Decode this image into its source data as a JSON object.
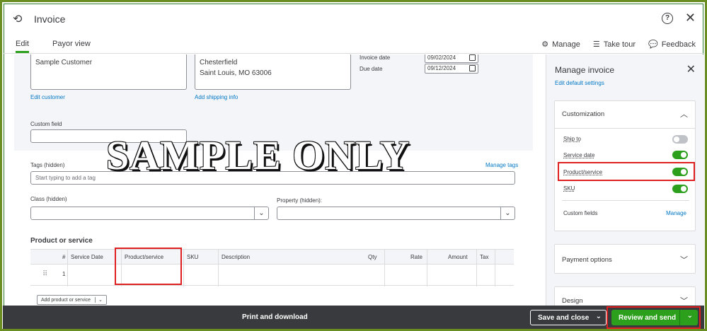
{
  "header": {
    "title": "Invoice",
    "help_label": "?",
    "close_label": "✕"
  },
  "tabs": [
    {
      "label": "Edit"
    },
    {
      "label": "Payor view"
    }
  ],
  "toolbar": {
    "manage": "Manage",
    "take_tour": "Take tour",
    "feedback": "Feedback"
  },
  "customer": {
    "name": "Sample Customer",
    "edit_link": "Edit customer",
    "shipping_line1": "Chesterfield",
    "shipping_line2": "Saint Louis, MO 63006",
    "add_shipping_link": "Add shipping info"
  },
  "dates": {
    "invoice_label": "Invoice date",
    "invoice_value": "09/02/2024",
    "due_label": "Due date",
    "due_value": "09/12/2024"
  },
  "custom_field": {
    "label": "Custom field",
    "value": ""
  },
  "tags": {
    "label": "Tags (hidden)",
    "manage_link": "Manage tags",
    "placeholder": "Start typing to add a tag"
  },
  "class_field": {
    "label": "Class (hidden)",
    "value": ""
  },
  "property_field": {
    "label": "Property (hidden):",
    "value": ""
  },
  "product_section": {
    "title": "Product or service",
    "columns": [
      "#",
      "Service Date",
      "Product/service",
      "SKU",
      "Description",
      "Qty",
      "Rate",
      "Amount",
      "Tax"
    ],
    "row_number": "1",
    "add_button": "Add product or service"
  },
  "watermark": "SAMPLE ONLY",
  "panel": {
    "title": "Manage invoice",
    "edit_defaults": "Edit default settings",
    "customization": {
      "title": "Customization",
      "options": [
        {
          "label": "Ship to",
          "enabled": false
        },
        {
          "label": "Service date",
          "enabled": true
        },
        {
          "label": "Product/service",
          "enabled": true
        },
        {
          "label": "SKU",
          "enabled": true
        }
      ],
      "custom_fields_label": "Custom fields",
      "custom_fields_manage": "Manage"
    },
    "payment_options": "Payment options",
    "design": "Design"
  },
  "footer": {
    "print": "Print and download",
    "save": "Save and close",
    "review": "Review and send"
  },
  "colors": {
    "accent": "#2ca01c",
    "link": "#0077c5",
    "footer_bg": "#393a3d",
    "highlight": "#e02020"
  }
}
